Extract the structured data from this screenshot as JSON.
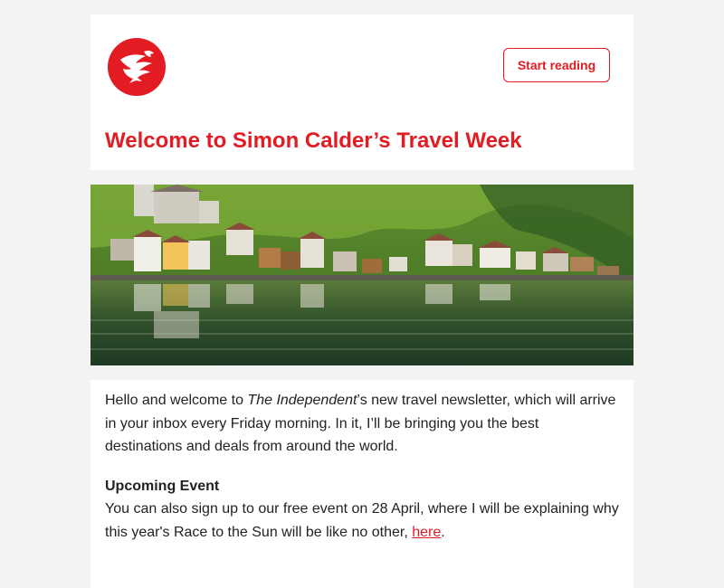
{
  "header": {
    "logo_icon": "independent-eagle-logo",
    "cta_label": "Start reading",
    "title": "Welcome to Simon Calder’s Travel Week"
  },
  "hero": {
    "image_subject": "lakeside alpine village with church and houses reflected in a lake"
  },
  "body": {
    "intro_prefix": "Hello and welcome to ",
    "intro_publication": "The Independent",
    "intro_suffix": "’s new travel newsletter, which will arrive in your inbox every Friday morning. In it, I’ll be bringing you the best destinations and deals from around the world.",
    "event_heading": "Upcoming Event",
    "event_text": "You can also sign up to our free event on 28 April, where I will be explaining why this year's Race to the Sun will be like no other, ",
    "event_link": "here",
    "event_end": "."
  },
  "colors": {
    "brand_red": "#e31b23",
    "page_background": "#f3f3f3"
  }
}
